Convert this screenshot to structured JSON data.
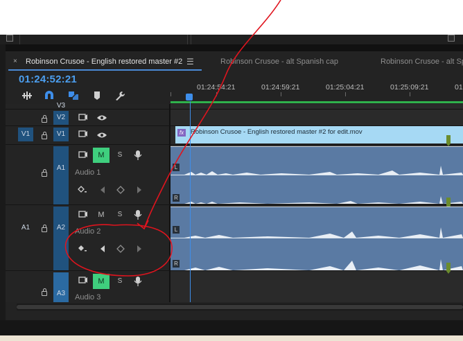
{
  "timeline": {
    "tabs": [
      {
        "label": "Robinson Crusoe - English restored master #2",
        "active": true
      },
      {
        "label": "Robinson Crusoe - alt Spanish cap",
        "active": false
      },
      {
        "label": "Robinson Crusoe - alt Spa",
        "active": false
      }
    ],
    "close_glyph": "×",
    "menu_glyph": "☰",
    "timecode": "01:24:52:21",
    "ruler_labels": [
      "01:24:54:21",
      "01:24:59:21",
      "01:25:04:21",
      "01:25:09:21",
      "01"
    ],
    "tools": [
      "nest-sequence-icon",
      "snap-magnet-icon",
      "linked-selection-icon",
      "add-marker-icon",
      "wrench-icon"
    ]
  },
  "tracks": {
    "v3": {
      "label": "V3"
    },
    "v2": {
      "label": "V2"
    },
    "v1": {
      "label": "V1",
      "source_label": "V1"
    },
    "a1": {
      "label": "A1",
      "name": "Audio 1",
      "mute": "M",
      "solo": "S"
    },
    "a2": {
      "label": "A2",
      "source_label": "A1",
      "name": "Audio 2",
      "mute": "M",
      "solo": "S"
    },
    "a3": {
      "label": "A3",
      "name": "Audio 3",
      "mute": "M",
      "solo": "S"
    }
  },
  "clips": {
    "video": {
      "fx": "fx",
      "name": "Robinson Crusoe - English restored master #2 for edit.mov"
    },
    "channel_left": "L",
    "channel_right": "R"
  },
  "colors": {
    "timecode": "#4c9ff0",
    "playhead": "#3e8eea",
    "mute_on": "#3fcf7e",
    "video_clip": "#a6d9f4",
    "audio_clip": "#5a7aa3",
    "annotation": "#e0141e"
  }
}
